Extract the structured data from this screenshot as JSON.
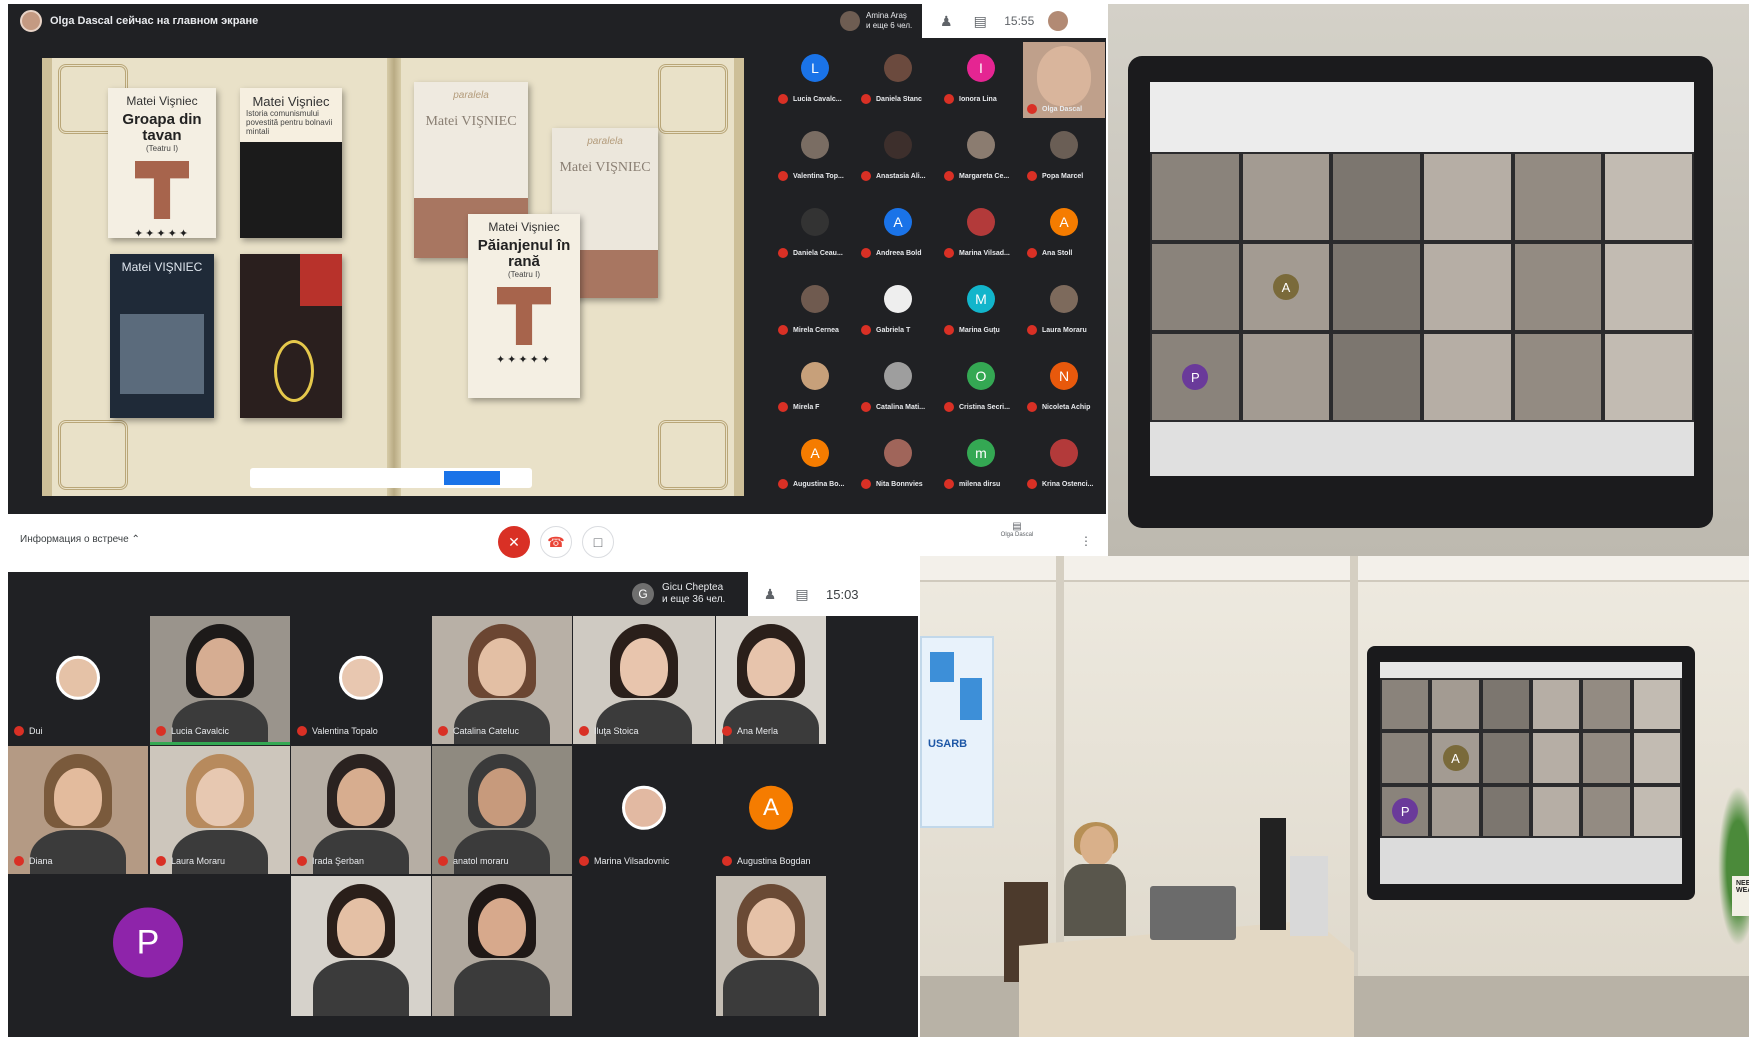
{
  "meet_presenting": {
    "presenter_label": "Olga Dascal сейчас на главном экране",
    "top_participant_name": "Amina Araş",
    "top_participant_sub": "и еще 6 чел.",
    "time": "15:55",
    "book_covers": [
      {
        "author": "Matei Vişniec",
        "title": "Groapa din tavan",
        "sub": "(Teatru I)"
      },
      {
        "author": "Matei Vişniec",
        "title": "",
        "sub": "Istoria comunismului povestită pentru bolnavii mintali"
      },
      {
        "author": "Matei VIŞNIEC",
        "title": "",
        "sub": ""
      },
      {
        "author": "Matei VIŞNIEC",
        "title": "",
        "sub": ""
      },
      {
        "author": "Matei VIŞNIEC",
        "title": "",
        "sub": ""
      },
      {
        "author": "Matei VIŞNIEC",
        "title": "",
        "sub": ""
      },
      {
        "author": "Matei Vişniec",
        "title": "Păianjenul în rană",
        "sub": "(Teatru I)"
      }
    ],
    "publisher_logo": "paralela",
    "participants": [
      {
        "name": "Lucia Cavalc...",
        "initial": "L",
        "color": "#1a73e8"
      },
      {
        "name": "Daniela Stanc",
        "initial": "",
        "color": "#6b4a3e"
      },
      {
        "name": "Ionora Lina",
        "initial": "I",
        "color": "#e52592"
      },
      {
        "name": "Olga Dascal",
        "initial": "",
        "color": "#bfa08b"
      },
      {
        "name": "Valentina Top...",
        "initial": "",
        "color": "#7a6d63"
      },
      {
        "name": "Anastasia Ali...",
        "initial": "",
        "color": "#3d2f2c"
      },
      {
        "name": "Margareta Ce...",
        "initial": "",
        "color": "#8b7c70"
      },
      {
        "name": "Popa Marcel",
        "initial": "",
        "color": "#6a5e55"
      },
      {
        "name": "Daniela Ceau...",
        "initial": "",
        "color": "#333333"
      },
      {
        "name": "Andreea Bold",
        "initial": "A",
        "color": "#1a73e8"
      },
      {
        "name": "Marina Vilsad...",
        "initial": "",
        "color": "#b33a3a"
      },
      {
        "name": "Ana Stoll",
        "initial": "A",
        "color": "#f57c00"
      },
      {
        "name": "Mirela Cernea",
        "initial": "",
        "color": "#6f5a4f"
      },
      {
        "name": "Gabriela T",
        "initial": "",
        "color": "#eeeeee"
      },
      {
        "name": "Marina Guţu",
        "initial": "M",
        "color": "#12b5cb"
      },
      {
        "name": "Laura Moraru",
        "initial": "",
        "color": "#7d6a5c"
      },
      {
        "name": "Mirela F",
        "initial": "",
        "color": "#c7a07a"
      },
      {
        "name": "Catalina Mati...",
        "initial": "",
        "color": "#9e9e9e"
      },
      {
        "name": "Cristina Secri...",
        "initial": "O",
        "color": "#34a853"
      },
      {
        "name": "Nicoleta Achip",
        "initial": "N",
        "color": "#e8590c"
      },
      {
        "name": "Augustina Bo...",
        "initial": "A",
        "color": "#f57c00"
      },
      {
        "name": "Nita Bonnvies",
        "initial": "",
        "color": "#a0655a"
      },
      {
        "name": "milena dirsu",
        "initial": "m",
        "color": "#34a853"
      },
      {
        "name": "Krina Ostenci...",
        "initial": "",
        "color": "#b33a3a"
      }
    ],
    "bottom_bar": {
      "info": "Информация о встрече",
      "presenter": "Olga Dascal"
    }
  },
  "meet_grid": {
    "top_participant_name": "Gicu Cheptea",
    "top_participant_sub": "и еще 36 чел.",
    "top_initial": "G",
    "time": "15:03",
    "tiles": [
      {
        "name": "Dui",
        "initial": "",
        "kind": "avatar"
      },
      {
        "name": "Lucia Cavalcic",
        "initial": "",
        "kind": "video"
      },
      {
        "name": "Valentina Topalo",
        "initial": "",
        "kind": "avatar"
      },
      {
        "name": "Catalina Cateluc",
        "initial": "",
        "kind": "video"
      },
      {
        "name": "Iluţa Stoica",
        "initial": "",
        "kind": "video"
      },
      {
        "name": "Ana Merla",
        "initial": "",
        "kind": "video"
      },
      {
        "name": "Diana",
        "initial": "",
        "kind": "video"
      },
      {
        "name": "Laura Moraru",
        "initial": "",
        "kind": "video"
      },
      {
        "name": "Irada Şerban",
        "initial": "",
        "kind": "video"
      },
      {
        "name": "anatol moraru",
        "initial": "",
        "kind": "video"
      },
      {
        "name": "Marina Vilsadovnic",
        "initial": "",
        "kind": "avatar"
      },
      {
        "name": "Augustina Bogdan",
        "initial": "A",
        "kind": "letter"
      },
      {
        "name": "",
        "initial": "P",
        "kind": "letter"
      },
      {
        "name": "",
        "initial": "",
        "kind": "video"
      },
      {
        "name": "",
        "initial": "",
        "kind": "video"
      },
      {
        "name": "",
        "initial": "",
        "kind": "video"
      }
    ]
  },
  "classroom_photo": {
    "poster_text": "USARB",
    "sign_text": "NEED WEA",
    "board_initials": [
      "A",
      "P"
    ]
  },
  "colors": {
    "meet_dark": "#202124",
    "mic_off_red": "#d93025",
    "end_call_red": "#ea4335",
    "blue": "#1a73e8"
  }
}
